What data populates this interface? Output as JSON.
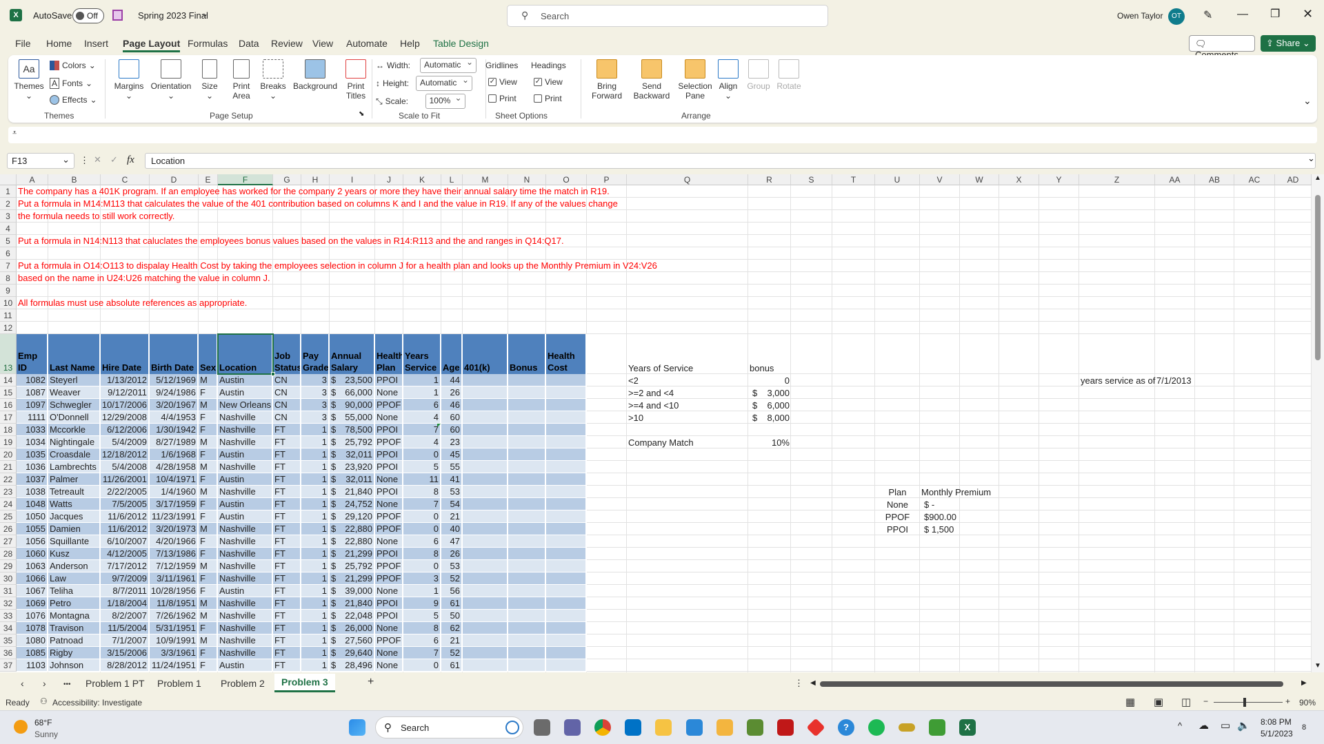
{
  "titlebar": {
    "autosave_label": "AutoSave",
    "autosave_state": "Off",
    "filename": "Spring 2023 Final",
    "search_placeholder": "Search",
    "user_name": "Owen Taylor",
    "user_initials": "OT"
  },
  "menu": {
    "items": [
      "File",
      "Home",
      "Insert",
      "Page Layout",
      "Formulas",
      "Data",
      "Review",
      "View",
      "Automate",
      "Help",
      "Table Design"
    ],
    "active": "Page Layout",
    "comments_label": "Comments",
    "share_label": "Share"
  },
  "ribbon": {
    "themes": {
      "themes": "Themes",
      "colors": "Colors",
      "fonts": "Fonts",
      "effects": "Effects",
      "group": "Themes"
    },
    "page_setup": {
      "margins": "Margins",
      "orientation": "Orientation",
      "size": "Size",
      "print_area": "Print Area",
      "breaks": "Breaks",
      "background": "Background",
      "print_titles": "Print Titles",
      "group": "Page Setup"
    },
    "scale": {
      "width_label": "Width:",
      "width_value": "Automatic",
      "height_label": "Height:",
      "height_value": "Automatic",
      "scale_label": "Scale:",
      "scale_value": "100%",
      "group": "Scale to Fit"
    },
    "sheet_options": {
      "gridlines": "Gridlines",
      "headings": "Headings",
      "view": "View",
      "print": "Print",
      "gridlines_view": true,
      "gridlines_print": false,
      "headings_view": true,
      "headings_print": false,
      "group": "Sheet Options"
    },
    "arrange": {
      "bring_forward": "Bring Forward",
      "send_backward": "Send Backward",
      "selection_pane": "Selection Pane",
      "align": "Align",
      "group_btn": "Group",
      "rotate": "Rotate",
      "group": "Arrange"
    }
  },
  "formula_bar": {
    "name_box": "F13",
    "fx": "fx",
    "value": "Location"
  },
  "sheet": {
    "columns": [
      "A",
      "B",
      "C",
      "D",
      "E",
      "F",
      "G",
      "H",
      "I",
      "J",
      "K",
      "L",
      "M",
      "N",
      "O",
      "P",
      "Q",
      "R",
      "S",
      "T",
      "U",
      "V",
      "W",
      "X",
      "Y",
      "Z",
      "AA",
      "AB",
      "AC",
      "AD"
    ],
    "selected_cell": "F13",
    "instructions": [
      {
        "row": 1,
        "text": "The company has a 401K program.  If an employee has worked for the company 2 years or more they have their annual salary time the match in R19."
      },
      {
        "row": 2,
        "text": "Put a formula in M14:M113 that calculates the value of the 401 contribution based on columns K and I and the value in R19.  If any of the values change"
      },
      {
        "row": 3,
        "text": "the formula needs to still work correctly."
      },
      {
        "row": 5,
        "text": "Put a formula in N14:N113 that caluclates the employees bonus values based on the values in R14:R113 and the and ranges in Q14:Q17."
      },
      {
        "row": 7,
        "text": "Put a formula in O14:O113 to dispalay Health Cost by taking the employees selection in column J for a health plan and looks up the Monthly Premium in V24:V26"
      },
      {
        "row": 8,
        "text": "based on the name in U24:U26 matching the value in column J."
      },
      {
        "row": 10,
        "text": "All formulas must use absolute references as appropriate."
      }
    ],
    "table": {
      "headers": [
        "Emp ID",
        "Last Name",
        "Hire Date",
        "Birth Date",
        "Sex",
        "Location",
        "Job Status",
        "Pay Grade",
        "Annual Salary",
        "Health Plan",
        "Years Service",
        "Age",
        "401(k)",
        "Bonus",
        "Health Cost"
      ],
      "rows": [
        [
          "1082",
          "Steyerl",
          "1/13/2012",
          "5/12/1969",
          "M",
          "Austin",
          "CN",
          "3",
          "$ 23,500",
          "PPOI",
          "1",
          "44",
          "",
          "",
          ""
        ],
        [
          "1087",
          "Weaver",
          "9/12/2011",
          "9/24/1986",
          "F",
          "Austin",
          "CN",
          "3",
          "$ 66,000",
          "None",
          "1",
          "26",
          "",
          "",
          ""
        ],
        [
          "1097",
          "Schwegler",
          "10/17/2006",
          "3/20/1967",
          "M",
          "New Orleans",
          "CN",
          "3",
          "$ 90,000",
          "PPOF",
          "6",
          "46",
          "",
          "",
          ""
        ],
        [
          "1111",
          "O'Donnell",
          "12/29/2008",
          "4/4/1953",
          "F",
          "Nashville",
          "CN",
          "3",
          "$ 55,000",
          "None",
          "4",
          "60",
          "",
          "",
          ""
        ],
        [
          "1033",
          "Mccorkle",
          "6/12/2006",
          "1/30/1942",
          "F",
          "Nashville",
          "FT",
          "1",
          "$ 78,500",
          "PPOI",
          "7",
          "60",
          "",
          "",
          ""
        ],
        [
          "1034",
          "Nightingale",
          "5/4/2009",
          "8/27/1989",
          "M",
          "Nashville",
          "FT",
          "1",
          "$ 25,792",
          "PPOF",
          "4",
          "23",
          "",
          "",
          ""
        ],
        [
          "1035",
          "Croasdale",
          "12/18/2012",
          "1/6/1968",
          "F",
          "Austin",
          "FT",
          "1",
          "$ 32,011",
          "PPOI",
          "0",
          "45",
          "",
          "",
          ""
        ],
        [
          "1036",
          "Lambrechts",
          "5/4/2008",
          "4/28/1958",
          "M",
          "Nashville",
          "FT",
          "1",
          "$ 23,920",
          "PPOI",
          "5",
          "55",
          "",
          "",
          ""
        ],
        [
          "1037",
          "Palmer",
          "11/26/2001",
          "10/4/1971",
          "F",
          "Austin",
          "FT",
          "1",
          "$ 32,011",
          "None",
          "11",
          "41",
          "",
          "",
          ""
        ],
        [
          "1038",
          "Tetreault",
          "2/22/2005",
          "1/4/1960",
          "M",
          "Nashville",
          "FT",
          "1",
          "$ 21,840",
          "PPOI",
          "8",
          "53",
          "",
          "",
          ""
        ],
        [
          "1048",
          "Watts",
          "7/5/2005",
          "3/17/1959",
          "F",
          "Austin",
          "FT",
          "1",
          "$ 24,752",
          "None",
          "7",
          "54",
          "",
          "",
          ""
        ],
        [
          "1050",
          "Jacques",
          "11/6/2012",
          "11/23/1991",
          "F",
          "Austin",
          "FT",
          "1",
          "$ 29,120",
          "PPOF",
          "0",
          "21",
          "",
          "",
          ""
        ],
        [
          "1055",
          "Damien",
          "11/6/2012",
          "3/20/1973",
          "M",
          "Nashville",
          "FT",
          "1",
          "$ 22,880",
          "PPOF",
          "0",
          "40",
          "",
          "",
          ""
        ],
        [
          "1056",
          "Squillante",
          "6/10/2007",
          "4/20/1966",
          "F",
          "Nashville",
          "FT",
          "1",
          "$ 22,880",
          "None",
          "6",
          "47",
          "",
          "",
          ""
        ],
        [
          "1060",
          "Kusz",
          "4/12/2005",
          "7/13/1986",
          "F",
          "Nashville",
          "FT",
          "1",
          "$ 21,299",
          "PPOI",
          "8",
          "26",
          "",
          "",
          ""
        ],
        [
          "1063",
          "Anderson",
          "7/17/2012",
          "7/12/1959",
          "M",
          "Nashville",
          "FT",
          "1",
          "$ 25,792",
          "PPOF",
          "0",
          "53",
          "",
          "",
          ""
        ],
        [
          "1066",
          "Law",
          "9/7/2009",
          "3/11/1961",
          "F",
          "Nashville",
          "FT",
          "1",
          "$ 21,299",
          "PPOF",
          "3",
          "52",
          "",
          "",
          ""
        ],
        [
          "1067",
          "Teliha",
          "8/7/2011",
          "10/28/1956",
          "F",
          "Austin",
          "FT",
          "1",
          "$ 39,000",
          "None",
          "1",
          "56",
          "",
          "",
          ""
        ],
        [
          "1069",
          "Petro",
          "1/18/2004",
          "11/8/1951",
          "M",
          "Nashville",
          "FT",
          "1",
          "$ 21,840",
          "PPOI",
          "9",
          "61",
          "",
          "",
          ""
        ],
        [
          "1076",
          "Montagna",
          "8/2/2007",
          "7/26/1962",
          "M",
          "Nashville",
          "FT",
          "1",
          "$ 22,048",
          "PPOI",
          "5",
          "50",
          "",
          "",
          ""
        ],
        [
          "1078",
          "Travison",
          "11/5/2004",
          "5/31/1951",
          "F",
          "Nashville",
          "FT",
          "1",
          "$ 26,000",
          "None",
          "8",
          "62",
          "",
          "",
          ""
        ],
        [
          "1080",
          "Patnoad",
          "7/1/2007",
          "10/9/1991",
          "M",
          "Nashville",
          "FT",
          "1",
          "$ 27,560",
          "PPOF",
          "6",
          "21",
          "",
          "",
          ""
        ],
        [
          "1085",
          "Rigby",
          "3/15/2006",
          "3/3/1961",
          "F",
          "Nashville",
          "FT",
          "1",
          "$ 29,640",
          "None",
          "7",
          "52",
          "",
          "",
          ""
        ],
        [
          "1103",
          "Johnson",
          "8/28/2012",
          "11/24/1951",
          "F",
          "Austin",
          "FT",
          "1",
          "$ 28,496",
          "None",
          "0",
          "61",
          "",
          "",
          ""
        ]
      ]
    },
    "bonus_table": {
      "header_range": "Years of Service",
      "header_bonus": "bonus",
      "rows": [
        {
          "range": "<2",
          "bonus": "0"
        },
        {
          "range": ">=2 and <4",
          "bonus": "$ 3,000"
        },
        {
          "range": ">=4 and <10",
          "bonus": "$ 6,000"
        },
        {
          "range": ">10",
          "bonus": "$ 8,000"
        }
      ]
    },
    "company_match": {
      "label": "Company Match",
      "value": "10%"
    },
    "years_service_as_of": {
      "label": "years service as of",
      "value": "7/1/2013"
    },
    "premium_table": {
      "header_plan": "Plan",
      "header_premium": "Monthly Premium",
      "rows": [
        {
          "plan": "None",
          "premium": "$ -"
        },
        {
          "plan": "PPOF",
          "premium": "$900.00"
        },
        {
          "plan": "PPOI",
          "premium": "$ 1,500"
        }
      ]
    },
    "colors": {
      "header": "#4f81bd",
      "band_dark": "#b8cce4",
      "band_light": "#dce6f1",
      "instruction_text": "#ff0000",
      "accent": "#1e7145"
    }
  },
  "sheet_tabs": {
    "tabs": [
      "Problem 1 PT",
      "Problem 1",
      "Problem 2",
      "Problem 3"
    ],
    "active": "Problem 3",
    "more": "•••",
    "add": "+"
  },
  "status": {
    "ready": "Ready",
    "accessibility": "Accessibility: Investigate",
    "zoom": "90%",
    "zoom_percent": 90
  },
  "taskbar": {
    "temp": "68°F",
    "weather": "Sunny",
    "search_placeholder": "Search",
    "time": "8:08 PM",
    "date": "5/1/2023",
    "notifications": "8"
  }
}
